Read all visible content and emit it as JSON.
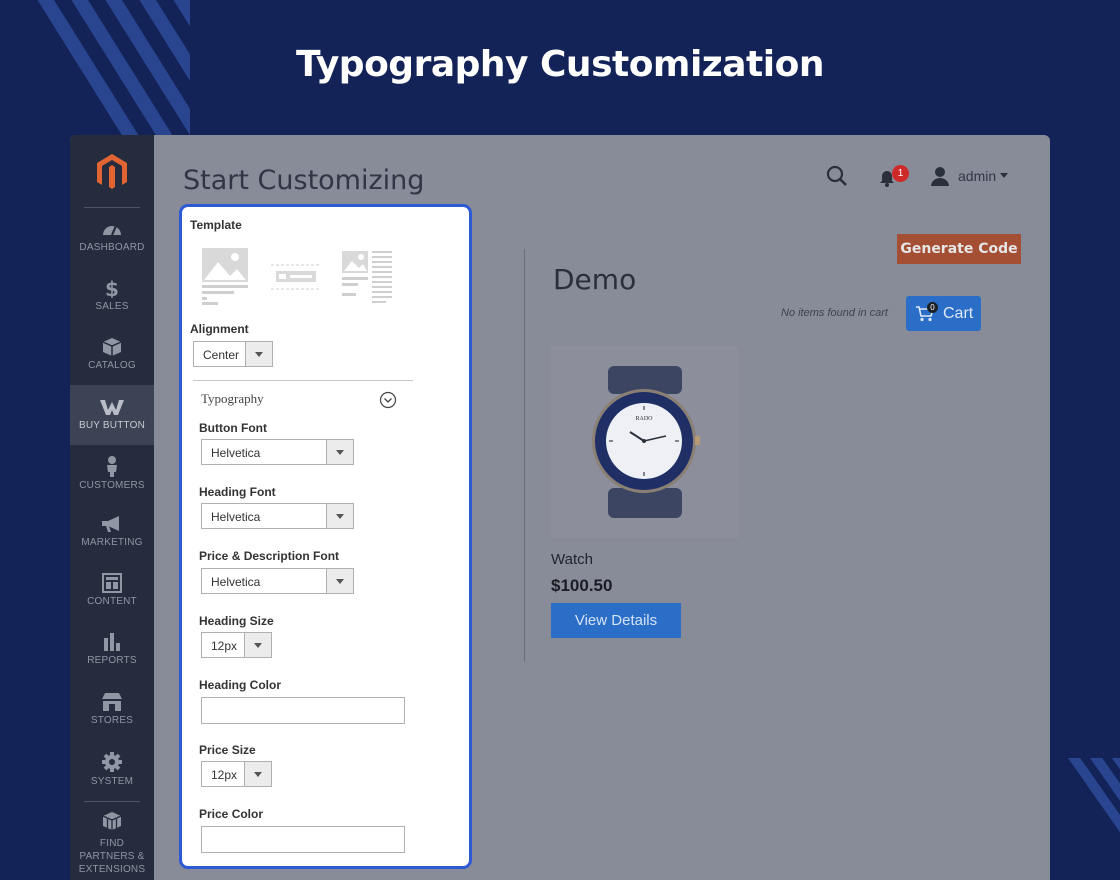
{
  "headline": "Typography Customization",
  "sidebar": {
    "logo_icon": "magento-logo-icon",
    "items": [
      {
        "label": "DASHBOARD",
        "icon": "dashboard-icon"
      },
      {
        "label": "SALES",
        "icon": "dollar-icon"
      },
      {
        "label": "CATALOG",
        "icon": "box-icon"
      },
      {
        "label": "BUY BUTTON",
        "icon": "buy-button-logo-icon",
        "active": true
      },
      {
        "label": "CUSTOMERS",
        "icon": "person-icon"
      },
      {
        "label": "MARKETING",
        "icon": "megaphone-icon"
      },
      {
        "label": "CONTENT",
        "icon": "layout-icon"
      },
      {
        "label": "REPORTS",
        "icon": "bar-chart-icon"
      },
      {
        "label": "STORES",
        "icon": "store-icon"
      },
      {
        "label": "SYSTEM",
        "icon": "gear-icon"
      },
      {
        "label": "FIND PARTNERS & EXTENSIONS",
        "icon": "cubes-icon"
      }
    ]
  },
  "header": {
    "title": "Start Customizing",
    "notification_count": "1",
    "user": "admin"
  },
  "form": {
    "template_label": "Template",
    "alignment_label": "Alignment",
    "alignment_value": "Center",
    "typography_title": "Typography",
    "button_font_label": "Button Font",
    "button_font_value": "Helvetica",
    "heading_font_label": "Heading Font",
    "heading_font_value": "Helvetica",
    "price_desc_font_label": "Price & Description Font",
    "price_desc_font_value": "Helvetica",
    "heading_size_label": "Heading Size",
    "heading_size_value": "12px",
    "heading_color_label": "Heading Color",
    "heading_color_value": "",
    "price_size_label": "Price Size",
    "price_size_value": "12px",
    "price_color_label": "Price Color",
    "price_color_value": ""
  },
  "preview": {
    "generate_label": "Generate Code",
    "demo_title": "Demo",
    "no_items": "No items found in cart",
    "cart_label": "Cart",
    "cart_count": "0",
    "watch_brand": "RADO",
    "product_name": "Watch",
    "product_price": "$100.50",
    "view_details": "View Details"
  },
  "colors": {
    "page_bg": "#132257",
    "sidebar_bg": "#242c3d",
    "panel_border": "#2d59d7",
    "generate_btn": "#a44f33",
    "primary_btn": "#2a6ec7",
    "badge": "#cf2a2a"
  }
}
